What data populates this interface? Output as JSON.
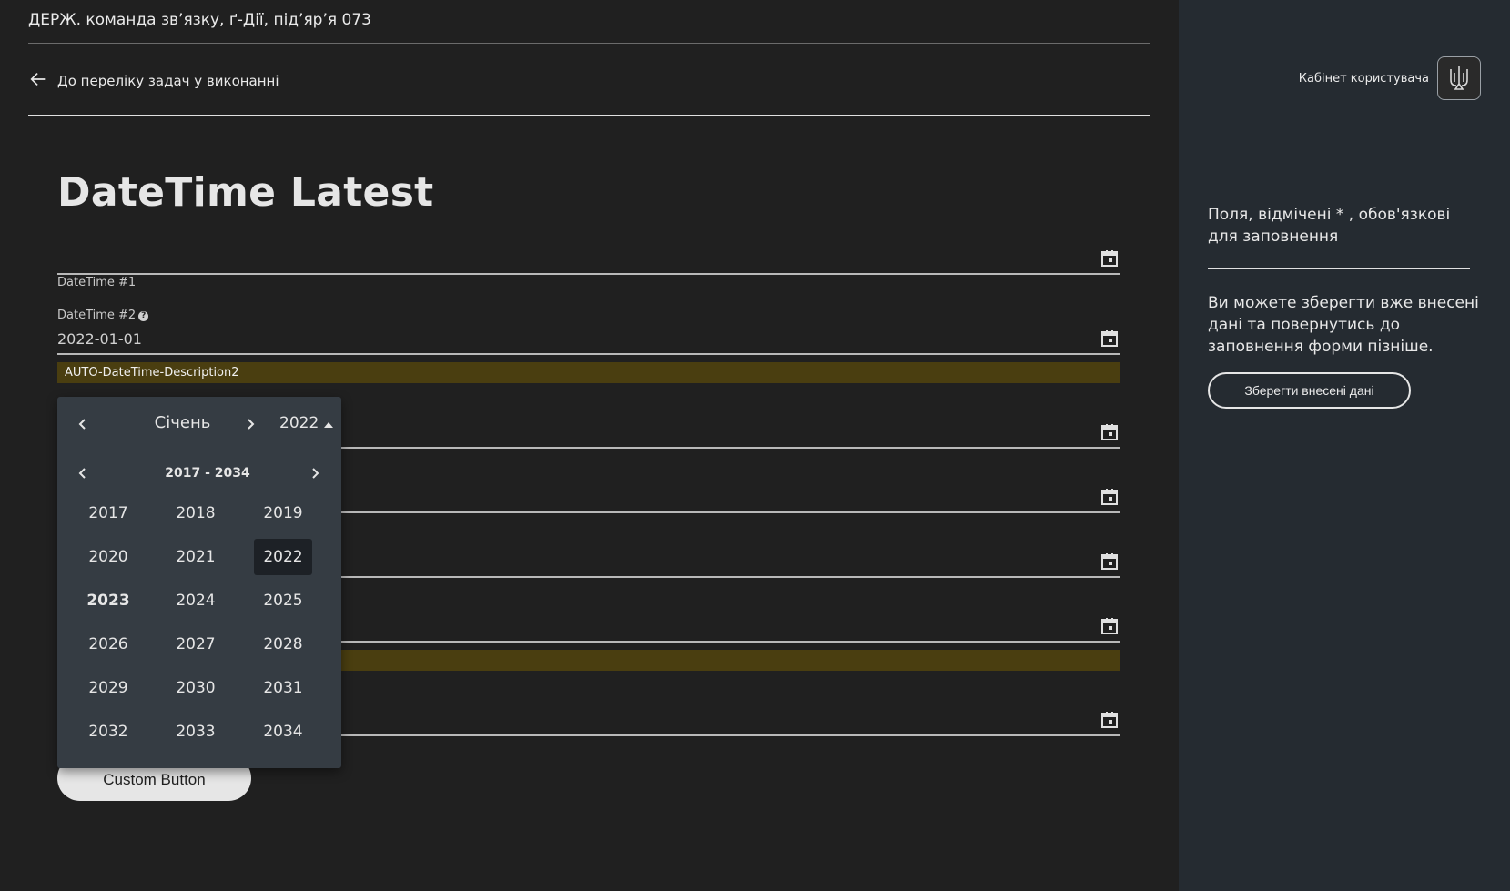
{
  "header": {
    "org_name": "ДЕРЖ. команда зв’язку, ґ-Дії, під’яр’я 073",
    "back_link": "До переліку задач у виконанні",
    "cabinet_label": "Кабінет користувача"
  },
  "form": {
    "title": "DateTime Latest",
    "fields": [
      {
        "label": "DateTime #1",
        "value": ""
      },
      {
        "label": "DateTime #2",
        "value": "2022-01-01",
        "description": "AUTO-DateTime-Description2"
      }
    ],
    "custom_button": "Custom Button"
  },
  "datepicker": {
    "month": "Січень",
    "year": "2022",
    "decade_range": "2017 - 2034",
    "years": [
      "2017",
      "2018",
      "2019",
      "2020",
      "2021",
      "2022",
      "2023",
      "2024",
      "2025",
      "2026",
      "2027",
      "2028",
      "2029",
      "2030",
      "2031",
      "2032",
      "2033",
      "2034"
    ],
    "selected_year": "2022",
    "current_year": "2023"
  },
  "sidebar": {
    "required_note": "Поля, відмічені * , обов'язкові для заповнення",
    "save_note": "Ви можете зберегти вже внесені дані та повернутись до заповнення форми пізніше.",
    "save_button": "Зберегти внесені дані"
  },
  "colors": {
    "background": "#202020",
    "sidebar": "#252b31",
    "description_bar": "#4a3e10",
    "picker_bg": "#353c43"
  }
}
